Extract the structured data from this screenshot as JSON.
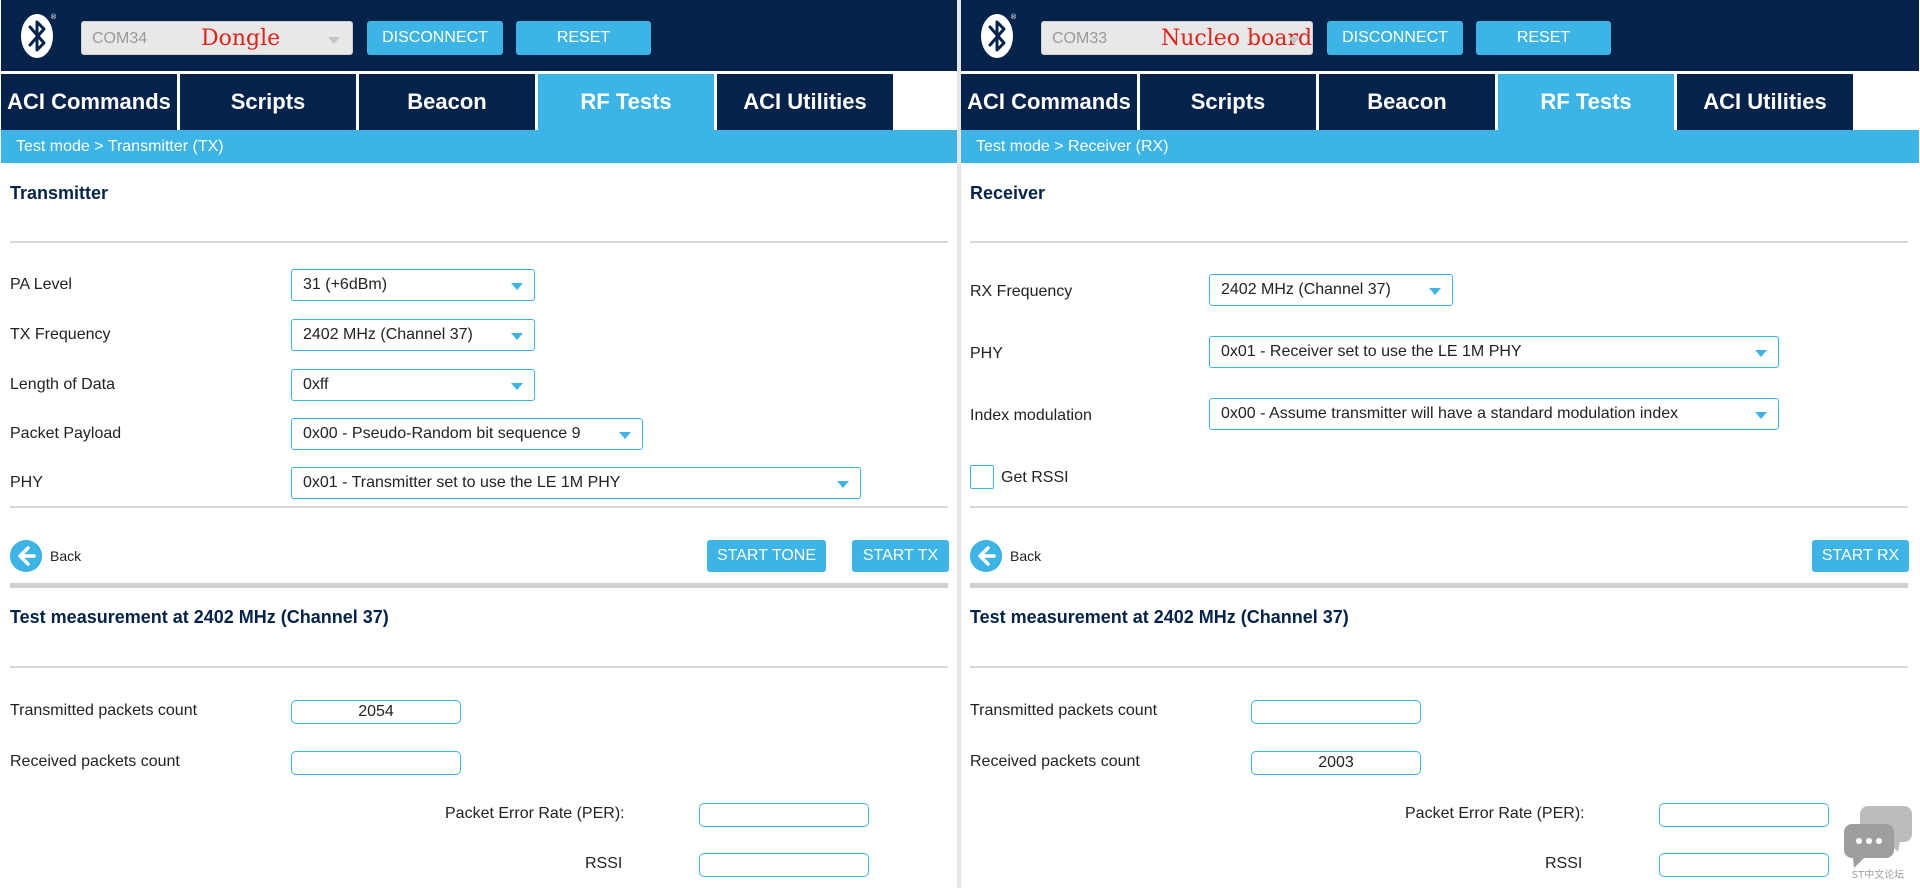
{
  "left": {
    "port": "COM34",
    "device_tag": "Dongle",
    "disconnect": "DISCONNECT",
    "reset": "RESET",
    "tabs": [
      "ACI Commands",
      "Scripts",
      "Beacon",
      "RF Tests",
      "ACI Utilities"
    ],
    "active_tab": "RF Tests",
    "breadcrumb": "Test mode  > Transmitter (TX)",
    "section_title": "Transmitter",
    "fields": [
      {
        "label": "PA Level",
        "value": "31 (+6dBm)"
      },
      {
        "label": "TX Frequency",
        "value": "2402 MHz (Channel 37)"
      },
      {
        "label": "Length of Data",
        "value": "0xff"
      },
      {
        "label": "Packet Payload",
        "value": "0x00 - Pseudo-Random bit sequence 9"
      },
      {
        "label": "PHY",
        "value": "0x01 - Transmitter set to use the LE 1M PHY"
      }
    ],
    "back": "Back",
    "start_tone": "START TONE",
    "start_tx": "START TX",
    "measure_title": "Test measurement at 2402 MHz (Channel 37)",
    "tx_count_label": "Transmitted packets count",
    "tx_count": "2054",
    "rx_count_label": "Received packets count",
    "rx_count": "",
    "per_label": "Packet Error Rate (PER):",
    "per": "",
    "rssi_label": "RSSI",
    "rssi": ""
  },
  "right": {
    "port": "COM33",
    "device_tag": "Nucleo board",
    "disconnect": "DISCONNECT",
    "reset": "RESET",
    "tabs": [
      "ACI Commands",
      "Scripts",
      "Beacon",
      "RF Tests",
      "ACI Utilities"
    ],
    "active_tab": "RF Tests",
    "breadcrumb": "Test mode  > Receiver (RX)",
    "section_title": "Receiver",
    "fields": [
      {
        "label": "RX Frequency",
        "value": "2402 MHz (Channel 37)"
      },
      {
        "label": "PHY",
        "value": "0x01 - Receiver set to use the LE 1M PHY"
      },
      {
        "label": "Index modulation",
        "value": "0x00 - Assume transmitter will have a standard modulation index"
      }
    ],
    "get_rssi": "Get RSSI",
    "back": "Back",
    "start_rx": "START RX",
    "measure_title": "Test measurement at 2402 MHz (Channel 37)",
    "tx_count_label": "Transmitted packets count",
    "tx_count": "",
    "rx_count_label": "Received packets count",
    "rx_count": "2003",
    "per_label": "Packet Error Rate (PER):",
    "per": "",
    "rssi_label": "RSSI",
    "rssi": ""
  },
  "watermark": "ST中文论坛",
  "colors": {
    "navy": "#03234b",
    "accent": "#3cb4e6",
    "tag_red": "#e2231a"
  }
}
